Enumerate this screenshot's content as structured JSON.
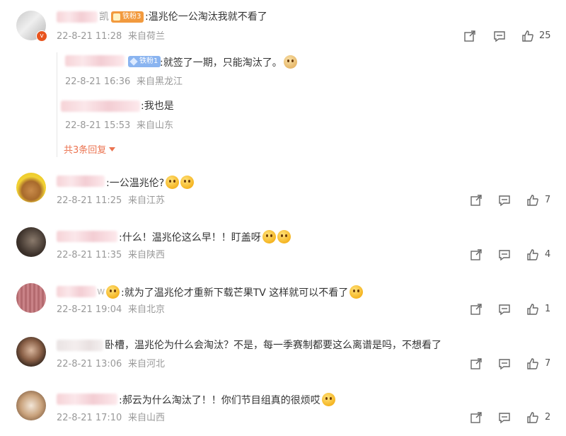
{
  "comments": [
    {
      "name_suffix": "凯",
      "badge": "铁粉3",
      "text": ":温兆伦一公淘汰我就不看了",
      "date": "22-8-21 11:28",
      "location": "来自荷兰",
      "likes": "25",
      "replies": [
        {
          "badge": "铁粉1",
          "text": ":就签了一期，只能淘汰了。",
          "date": "22-8-21 16:36",
          "location": "来自黑龙江"
        },
        {
          "text": ":我也是",
          "date": "22-8-21 15:53",
          "location": "来自山东"
        }
      ],
      "more_replies": "共3条回复"
    },
    {
      "text": ":一公温兆伦?",
      "date": "22-8-21 11:25",
      "location": "来自江苏",
      "likes": "7"
    },
    {
      "text": ":什么！温兆伦这么早！！盯盖呀",
      "date": "22-8-21 11:35",
      "location": "来自陕西",
      "likes": "4"
    },
    {
      "name_suffix": "w",
      "text": ":就为了温兆伦才重新下载芒果TV 这样就可以不看了",
      "date": "22-8-21 19:04",
      "location": "来自北京",
      "likes": "1"
    },
    {
      "text": "卧槽，温兆伦为什么会淘汰？不是，每一季赛制都要这么离谱是吗，不想看了",
      "date": "22-8-21 13:06",
      "location": "来自河北",
      "likes": "7"
    },
    {
      "text": ":郝云为什么淘汰了！！你们节目组真的很烦哎",
      "date": "22-8-21 17:10",
      "location": "来自山西",
      "likes": "2"
    }
  ],
  "colors": {
    "meta": "#999999",
    "accent": "#eb7350",
    "badge_fan3": "#f29a3e",
    "badge_fan1": "#8ab4f0"
  },
  "icons": [
    "share-icon",
    "comment-icon",
    "like-icon",
    "verified-icon",
    "chevron-down-icon"
  ]
}
